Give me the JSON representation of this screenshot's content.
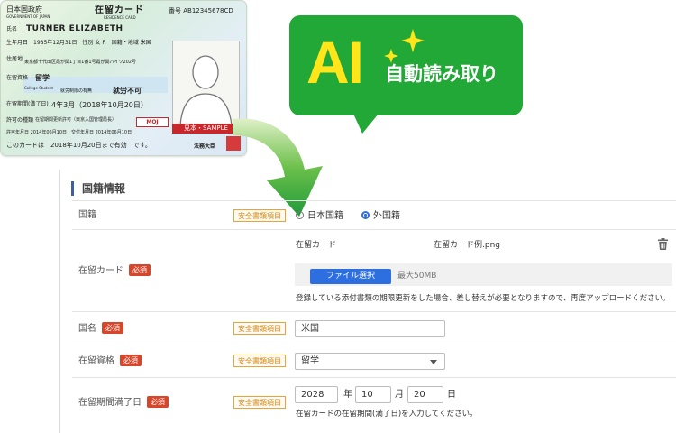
{
  "card": {
    "gov": "日本国政府",
    "gov_en": "GOVERNMENT OF JAPAN",
    "title": "在留カード",
    "title_en": "RESIDENCE CARD",
    "number": "番号 AB12345678CD",
    "name_label": "氏名",
    "name": "TURNER  ELIZABETH",
    "dob": "生年月日　1985年12月31日　性別 女 F.　国籍・地域 米国",
    "address_label": "住居地",
    "address": "東京都千代田区霞が関1丁目1番1号霞が関ハイツ202号",
    "status_label": "在留資格",
    "status": "留学",
    "status_en": "College Student",
    "work_label": "就労制限の有無",
    "work": "就労不可",
    "period_label": "在留期間(満了日)",
    "period": "4年3月（2018年10月20日）",
    "permit_label": "許可の種類",
    "permit": "在留期間更新許可（東京入国管理局長）",
    "issue": "許可年月日 2014年06月10日　交付年月日 2014年06月10日",
    "valid": "このカードは　2018年10月20日まで有効　です。",
    "sample": "見本・SAMPLE",
    "moj": "MOJ",
    "minister": "法務大臣",
    "stamp": "法務大臣印"
  },
  "ai": {
    "title": "AI",
    "subtitle": "自動読み取り"
  },
  "section": {
    "title": "国籍情報"
  },
  "safe_tag": "安全書類項目",
  "required_tag": "必須",
  "nationality": {
    "label": "国籍",
    "options": [
      "日本国籍",
      "外国籍"
    ],
    "selected": "外国籍"
  },
  "residence_card": {
    "label": "在留カード",
    "doc_name": "在留カード",
    "file_name": "在留カード例.png",
    "choose_file": "ファイル選択",
    "max_size": "最大50MB",
    "note": "登録している添付書類の期限更新をした場合、差し替えが必要となりますので、再度アップロードください。"
  },
  "country": {
    "label": "国名",
    "value": "米国"
  },
  "status": {
    "label": "在留資格",
    "value": "留学"
  },
  "expiry": {
    "label": "在留期間満了日",
    "year": "2028",
    "year_unit": "年",
    "month": "10",
    "month_unit": "月",
    "day": "20",
    "day_unit": "日",
    "hint": "在留カードの在留期間(満了日)を入力してください。"
  },
  "colors": {
    "bubble": "#22a837",
    "ai_text": "#ffe51a",
    "primary": "#2d6fe0",
    "required": "#d7462b",
    "safe_tag": "#e8a33a"
  }
}
